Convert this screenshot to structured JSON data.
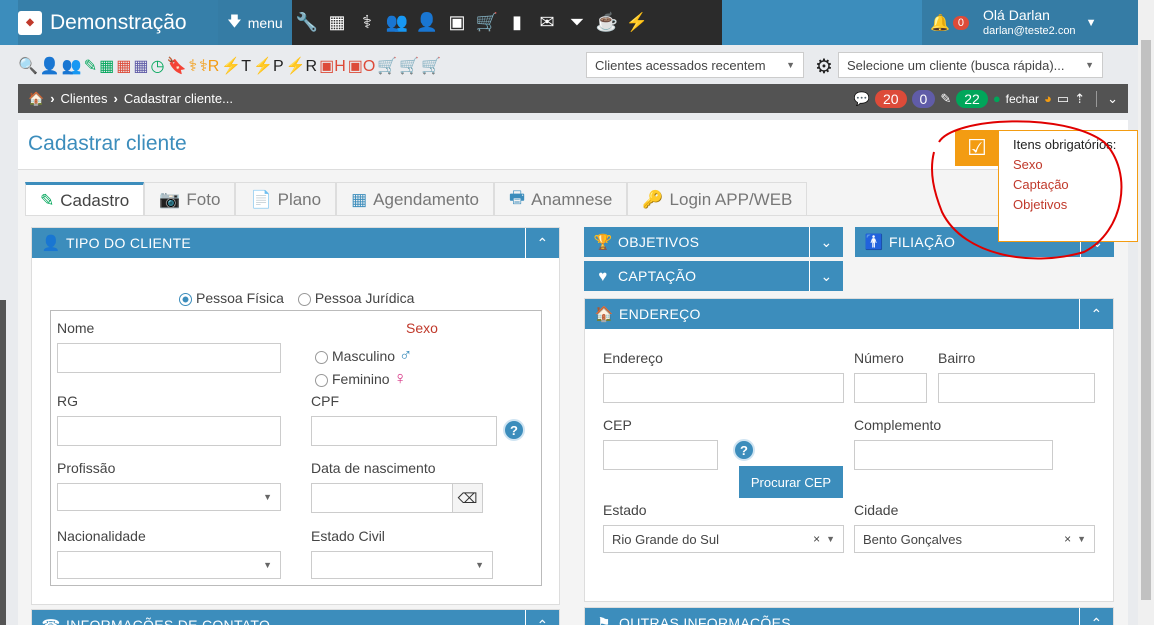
{
  "app": {
    "title": "Demonstração",
    "menu_label": "menu"
  },
  "toolbar_icons": [
    "wrench-icon",
    "calendar-icon",
    "stethoscope-icon",
    "users-icon",
    "user-plus-icon",
    "money-icon",
    "cart-icon",
    "file-icon",
    "envelope-icon",
    "filter-icon",
    "coffee-icon",
    "bolt-icon"
  ],
  "user": {
    "greeting": "Olá Darlan",
    "email": "darlan@teste2.con",
    "notifications": "0"
  },
  "icon_row": [
    {
      "icon": "🔍",
      "color": "#00a65a"
    },
    {
      "icon": "👤",
      "color": "#00a65a"
    },
    {
      "icon": "👥",
      "color": "#00a65a"
    },
    {
      "icon": "✎",
      "color": "#00a65a"
    },
    {
      "icon": "▦",
      "color": "#00a65a"
    },
    {
      "icon": "▦",
      "color": "#dd4b39"
    },
    {
      "icon": "▦",
      "color": "#605ca8"
    },
    {
      "icon": "◷",
      "color": "#00a65a"
    },
    {
      "icon": "🔖",
      "color": "#605ca8"
    },
    {
      "icon": "⚕",
      "color": "#f39c12"
    },
    {
      "icon": "⚕R",
      "color": "#f39c12"
    },
    {
      "icon": "⚡T",
      "color": "#222"
    },
    {
      "icon": "⚡P",
      "color": "#222"
    },
    {
      "icon": "⚡R",
      "color": "#222"
    },
    {
      "icon": "▣H",
      "color": "#dd4b39"
    },
    {
      "icon": "▣O",
      "color": "#dd4b39"
    },
    {
      "icon": "🛒",
      "color": "#3c8dbc"
    },
    {
      "icon": "🛒",
      "color": "#dd4b39"
    },
    {
      "icon": "🛒",
      "color": "#605ca8"
    }
  ],
  "selects": {
    "recent_clients": "Clientes acessados recentem",
    "quick_search": "Selecione um cliente (busca rápida)..."
  },
  "breadcrumb": {
    "items": [
      "Clientes",
      "Cadastrar cliente..."
    ],
    "count_red": "20",
    "count_purple": "0",
    "count_green": "22",
    "close_label": "fechar"
  },
  "page": {
    "title": "Cadastrar cliente"
  },
  "required": {
    "title": "Itens obrigatórios:",
    "items": [
      "Sexo",
      "Captação",
      "Objetivos"
    ]
  },
  "tabs": [
    {
      "label": "Cadastro",
      "icon": "✎"
    },
    {
      "label": "Foto",
      "icon": "📷"
    },
    {
      "label": "Plano",
      "icon": "📄"
    },
    {
      "label": "Agendamento",
      "icon": "▦"
    },
    {
      "label": "Anamnese",
      "icon": "🖶"
    },
    {
      "label": "Login APP/WEB",
      "icon": "🔑"
    }
  ],
  "client_type": {
    "header": "TIPO DO CLIENTE",
    "person_physical": "Pessoa Física",
    "person_legal": "Pessoa Jurídica",
    "name_label": "Nome",
    "sex_label": "Sexo",
    "male": "Masculino",
    "female": "Feminino",
    "rg_label": "RG",
    "cpf_label": "CPF",
    "profession_label": "Profissão",
    "birth_label": "Data de nascimento",
    "nationality_label": "Nacionalidade",
    "civil_label": "Estado Civil"
  },
  "contact_header": "INFORMAÇÕES DE CONTATO",
  "objectives_header": "OBJETIVOS",
  "affiliation_header": "FILIAÇÃO",
  "capture_header": "CAPTAÇÃO",
  "address": {
    "header": "ENDEREÇO",
    "street_label": "Endereço",
    "number_label": "Número",
    "district_label": "Bairro",
    "cep_label": "CEP",
    "complement_label": "Complemento",
    "search_cep": "Procurar CEP",
    "state_label": "Estado",
    "state_value": "Rio Grande do Sul",
    "city_label": "Cidade",
    "city_value": "Bento Gonçalves"
  },
  "other_header": "OUTRAS INFORMAÇÕES",
  "help_mark": "?",
  "clear_mark": "×"
}
